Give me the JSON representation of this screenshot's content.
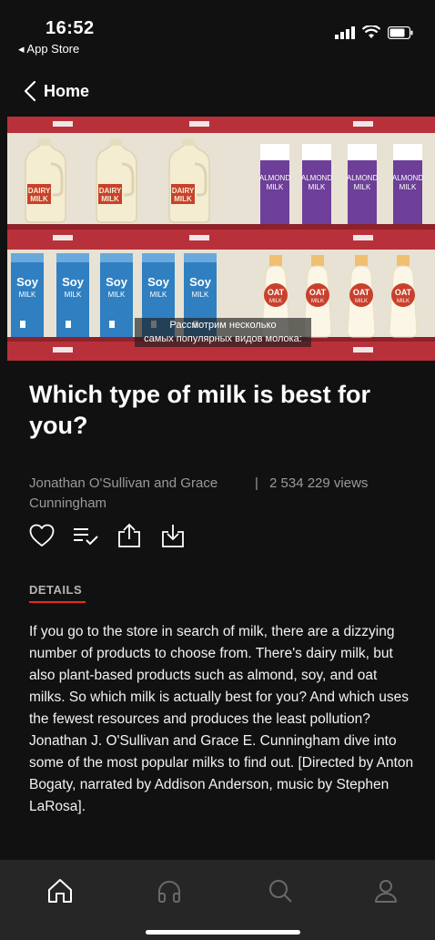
{
  "status_bar": {
    "time": "16:52",
    "back_app": "◂ App Store"
  },
  "nav": {
    "back_label": "Home"
  },
  "video": {
    "subtitle_line1": "Рассмотрим несколько",
    "subtitle_line2": "самых популярных видов молока:",
    "labels": {
      "dairy_1": "DAIRY",
      "dairy_2": "MILK",
      "almond_1": "ALMOND",
      "almond_2": "MILK",
      "soy_1": "Soy",
      "soy_2": "MILK",
      "oat_1": "OAT",
      "oat_2": "MILK"
    },
    "colors": {
      "shelf": "#b8313a",
      "wall": "#e8e2d4",
      "almond": "#6d3f98",
      "soy": "#2f7fc1",
      "dairy_label": "#c8412c"
    }
  },
  "talk": {
    "title": "Which type of milk is best for you?",
    "authors": "Jonathan O'Sullivan and Grace Cunningham",
    "separator": "|",
    "views": "2 534 229 views"
  },
  "actions": {
    "icons": [
      "heart-icon",
      "playlist-add-icon",
      "share-icon",
      "download-icon"
    ]
  },
  "details": {
    "label": "DETAILS",
    "accent": "#e62b1e",
    "description": "If you go to the store in search of milk, there are a dizzying number of products to choose from. There's dairy milk, but also plant-based products such as almond, soy, and oat milks. So which milk is actually best for you? And which uses the fewest resources and produces the least pollution? Jonathan J. O'Sullivan and Grace E. Cunningham dive into some of the most popular milks to find out. [Directed by Anton Bogaty, narrated by Addison Anderson, music by Stephen LaRosa]."
  },
  "tabbar": {
    "tabs": [
      "home-icon",
      "headphones-icon",
      "search-icon",
      "profile-icon"
    ],
    "active": "home-icon"
  }
}
